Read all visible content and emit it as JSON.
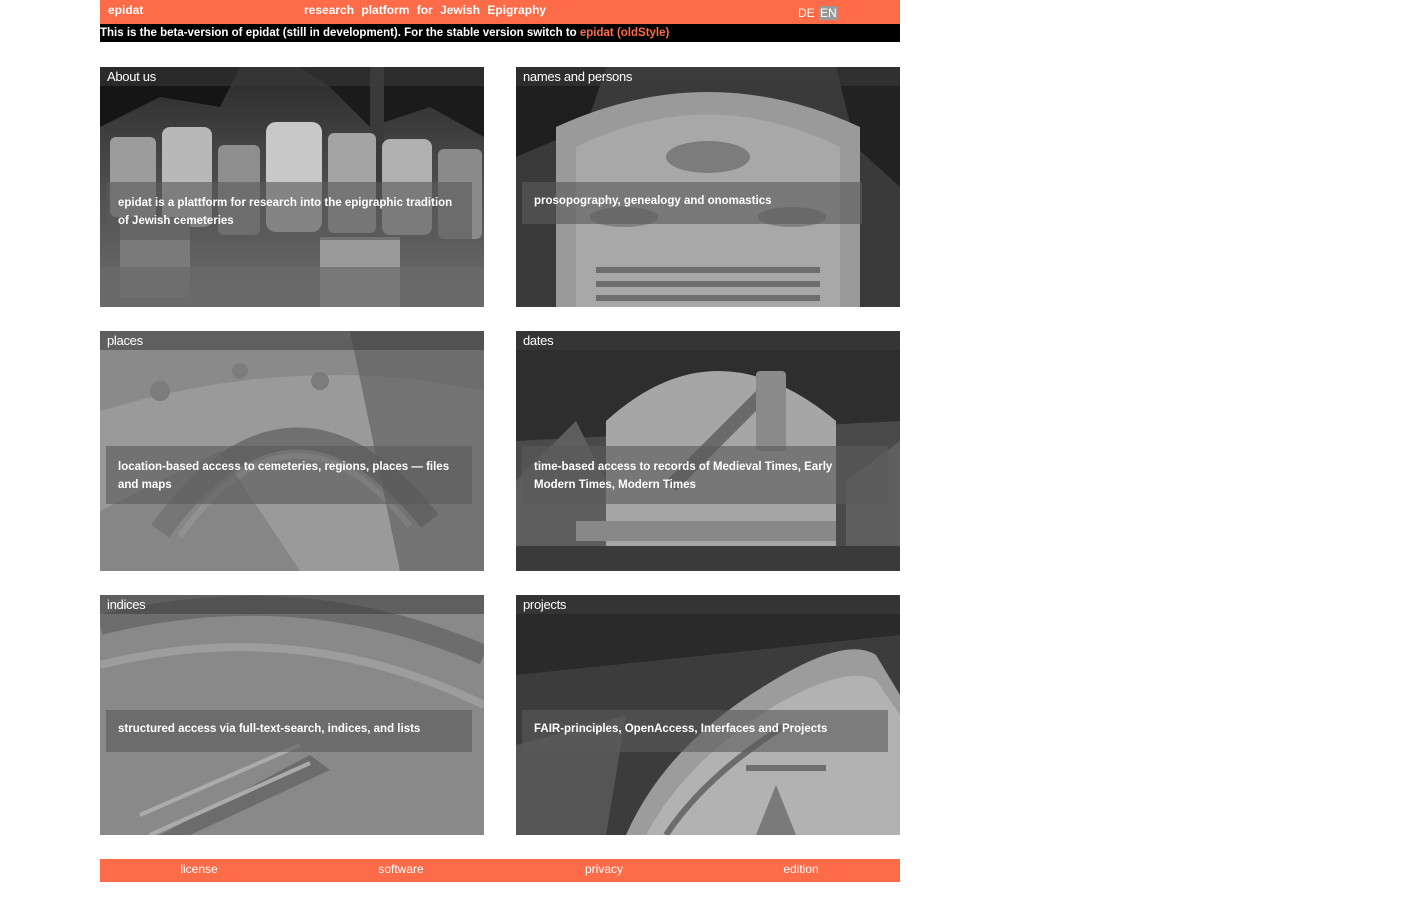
{
  "header": {
    "brand": "epidat",
    "tagline": "research platform for Jewish Epigraphy",
    "languages": [
      {
        "label": "DE",
        "active": false
      },
      {
        "label": "EN",
        "active": true
      }
    ],
    "accent_color": "#fe6b49"
  },
  "beta_notice": {
    "text": "This is the beta-version of epidat (still in development). For the stable version switch to ",
    "link_label": "epidat (oldStyle)"
  },
  "tiles": [
    {
      "title": "About us",
      "description": "epidat is a plattform for research into the epigraphic tradition of Jewish cemeteries"
    },
    {
      "title": "names and persons",
      "description": "prosopography, genealogy and onomastics"
    },
    {
      "title": "places",
      "description": "location-based access to cemeteries, regions, places — files and maps"
    },
    {
      "title": "dates",
      "description": "time-based access to records of Medieval Times, Early Modern Times, Modern Times"
    },
    {
      "title": "indices",
      "description": "structured access via full-text-search, indices, and lists"
    },
    {
      "title": "projects",
      "description": "FAIR-principles, OpenAccess, Interfaces and Projects"
    }
  ],
  "footer": {
    "links": [
      "license",
      "software",
      "privacy",
      "edition"
    ]
  }
}
